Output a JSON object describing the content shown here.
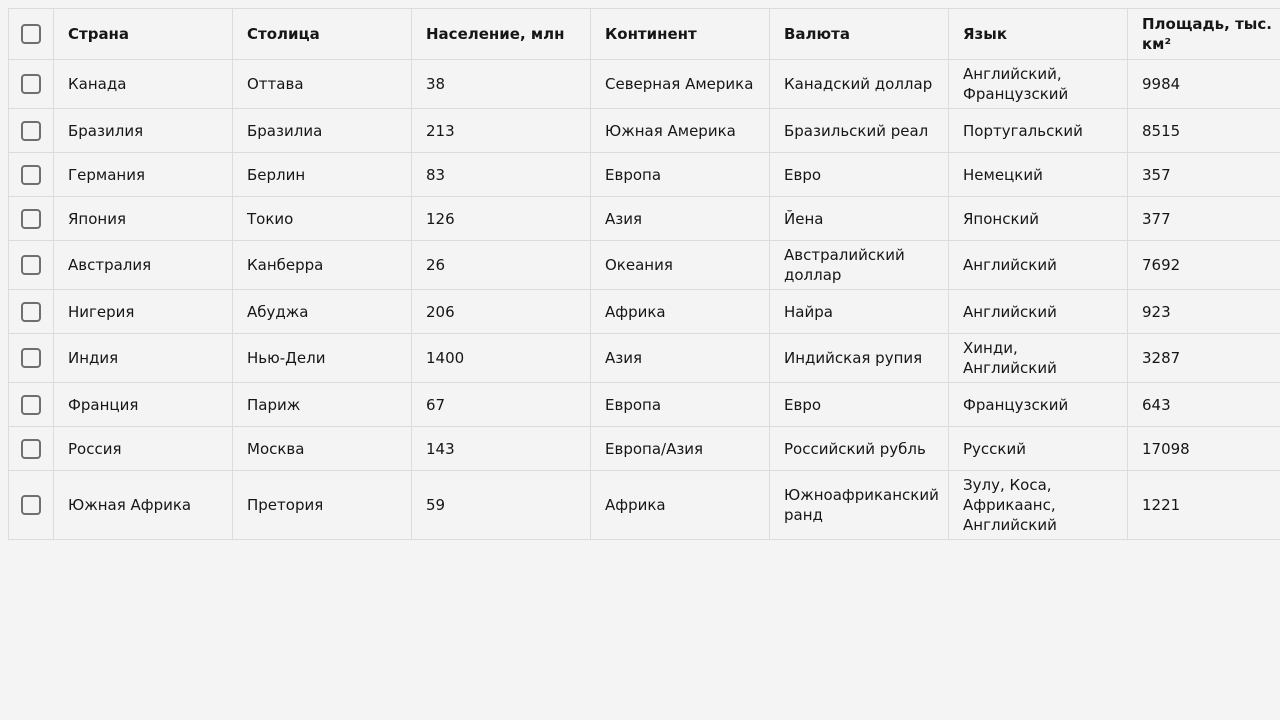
{
  "table": {
    "columns": [
      "Страна",
      "Столица",
      "Население, млн",
      "Континент",
      "Валюта",
      "Язык",
      "Площадь, тыс. км²"
    ],
    "rows": [
      [
        "Канада",
        "Оттава",
        "38",
        "Северная Америка",
        "Канадский доллар",
        "Английский, Французский",
        "9984"
      ],
      [
        "Бразилия",
        "Бразилиа",
        "213",
        "Южная Америка",
        "Бразильский реал",
        "Португальский",
        "8515"
      ],
      [
        "Германия",
        "Берлин",
        "83",
        "Европа",
        "Евро",
        "Немецкий",
        "357"
      ],
      [
        "Япония",
        "Токио",
        "126",
        "Азия",
        "Йена",
        "Японский",
        "377"
      ],
      [
        "Австралия",
        "Канберра",
        "26",
        "Океания",
        "Австралийский доллар",
        "Английский",
        "7692"
      ],
      [
        "Нигерия",
        "Абуджа",
        "206",
        "Африка",
        "Найра",
        "Английский",
        "923"
      ],
      [
        "Индия",
        "Нью-Дели",
        "1400",
        "Азия",
        "Индийская рупия",
        "Хинди, Английский",
        "3287"
      ],
      [
        "Франция",
        "Париж",
        "67",
        "Европа",
        "Евро",
        "Французский",
        "643"
      ],
      [
        "Россия",
        "Москва",
        "143",
        "Европа/Азия",
        "Российский рубль",
        "Русский",
        "17098"
      ],
      [
        "Южная Африка",
        "Претория",
        "59",
        "Африка",
        "Южноафриканский ранд",
        "Зулу, Коса, Африкаанс, Английский",
        "1221"
      ]
    ]
  },
  "colors": {
    "background": "#f4f4f4",
    "border": "#dcdcdc",
    "checkbox_border": "#6f6f6f",
    "text": "#161616"
  }
}
